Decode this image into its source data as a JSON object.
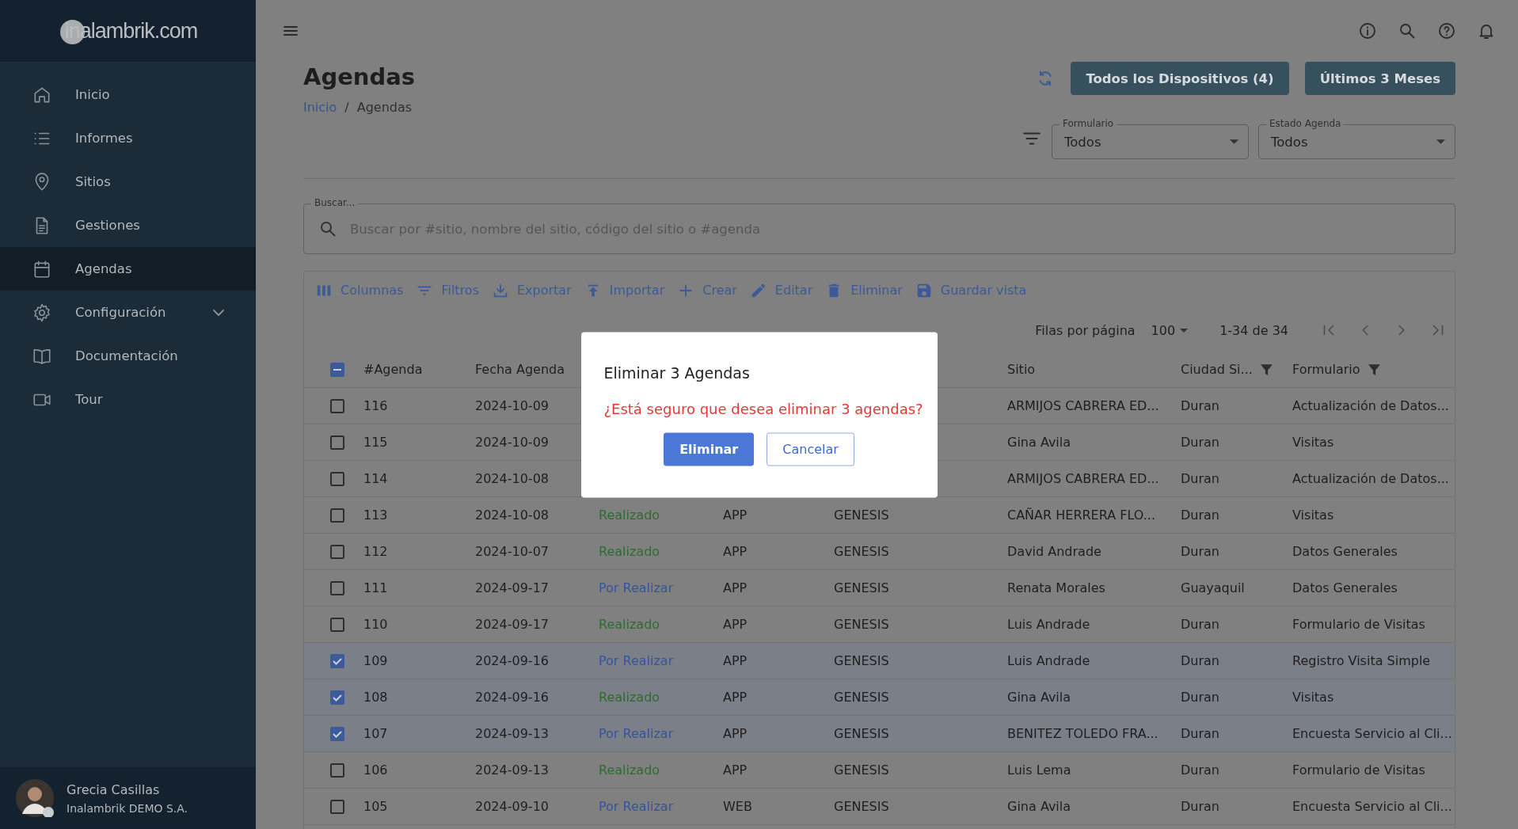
{
  "sidebar": {
    "logo": "inalambrik.com",
    "items": [
      {
        "label": "Inicio",
        "selected": false
      },
      {
        "label": "Informes",
        "selected": false
      },
      {
        "label": "Sitios",
        "selected": false
      },
      {
        "label": "Gestiones",
        "selected": false
      },
      {
        "label": "Agendas",
        "selected": true
      },
      {
        "label": "Configuración",
        "selected": false,
        "expanded": false
      },
      {
        "label": "Documentación",
        "selected": false
      },
      {
        "label": "Tour",
        "selected": false
      }
    ],
    "user": {
      "name": "Grecia Casillas",
      "company": "Inalambrik DEMO S.A."
    }
  },
  "page": {
    "title": "Agendas",
    "breadcrumb": [
      {
        "label": "Inicio",
        "kind": "link"
      },
      {
        "label": "/",
        "kind": "separator"
      },
      {
        "label": "Agendas",
        "kind": "current"
      }
    ],
    "actions": [
      "Todos los Dispositivos (4)",
      "Últimos 3 Meses"
    ],
    "filters": [
      {
        "label": "Formulario",
        "value": "Todos"
      },
      {
        "label": "Estado Agenda",
        "value": "Todos"
      }
    ],
    "search": {
      "label": "Buscar...",
      "placeholder": "Buscar por #sitio, nombre del sitio, código del sitio o #agenda"
    }
  },
  "toolbar": [
    "Columnas",
    "Filtros",
    "Exportar",
    "Importar",
    "Crear",
    "Editar",
    "Eliminar",
    "Guardar vista"
  ],
  "pagination": {
    "rows_label": "Filas por página",
    "rows_per_page": "100",
    "range": "1-34 de 34"
  },
  "table": {
    "header_partial": true,
    "columns": [
      {
        "label": "#Agenda",
        "filtered": false
      },
      {
        "label": "Fecha Agenda",
        "filtered": false
      },
      null,
      null,
      null,
      {
        "label": "Sitio",
        "filtered": false
      },
      {
        "label": "Ciudad Si...",
        "filtered": true
      },
      {
        "label": "Formulario",
        "filtered": true
      }
    ],
    "rows": [
      {
        "selected": false,
        "agenda": "116",
        "date": "2024-10-09",
        "site": "ARMIJOS CABRERA ED...",
        "city": "Duran",
        "form": "Actualización de Datos..."
      },
      {
        "selected": false,
        "agenda": "115",
        "date": "2024-10-09",
        "site": "Gina Avila",
        "city": "Duran",
        "form": "Visitas"
      },
      {
        "selected": false,
        "agenda": "114",
        "date": "2024-10-08",
        "site": "ARMIJOS CABRERA ED...",
        "city": "Duran",
        "form": "Actualización de Datos..."
      },
      {
        "selected": false,
        "agenda": "113",
        "date": "2024-10-08",
        "status": "Realizado",
        "done": true,
        "origin": "APP",
        "company": "GENESIS",
        "site": "CAÑAR HERRERA FLO...",
        "city": "Duran",
        "form": "Visitas"
      },
      {
        "selected": false,
        "agenda": "112",
        "date": "2024-10-07",
        "status": "Realizado",
        "done": true,
        "origin": "APP",
        "company": "GENESIS",
        "site": "David Andrade",
        "city": "Duran",
        "form": "Datos Generales"
      },
      {
        "selected": false,
        "agenda": "111",
        "date": "2024-09-17",
        "status": "Por Realizar",
        "done": false,
        "origin": "APP",
        "company": "GENESIS",
        "site": "Renata Morales",
        "city": "Guayaquil",
        "form": "Datos Generales"
      },
      {
        "selected": false,
        "agenda": "110",
        "date": "2024-09-17",
        "status": "Realizado",
        "done": true,
        "origin": "APP",
        "company": "GENESIS",
        "site": "Luis Andrade",
        "city": "Duran",
        "form": "Formulario de Visitas"
      },
      {
        "selected": true,
        "agenda": "109",
        "date": "2024-09-16",
        "status": "Por Realizar",
        "done": false,
        "origin": "APP",
        "company": "GENESIS",
        "site": "Luis Andrade",
        "city": "Duran",
        "form": "Registro Visita Simple"
      },
      {
        "selected": true,
        "agenda": "108",
        "date": "2024-09-16",
        "status": "Realizado",
        "done": true,
        "origin": "APP",
        "company": "GENESIS",
        "site": "Gina Avila",
        "city": "Duran",
        "form": "Visitas"
      },
      {
        "selected": true,
        "agenda": "107",
        "date": "2024-09-13",
        "status": "Por Realizar",
        "done": false,
        "origin": "APP",
        "company": "GENESIS",
        "site": "BENITEZ TOLEDO FRA...",
        "city": "Duran",
        "form": "Encuesta Servicio al Cli..."
      },
      {
        "selected": false,
        "agenda": "106",
        "date": "2024-09-13",
        "status": "Realizado",
        "done": true,
        "origin": "APP",
        "company": "GENESIS",
        "site": "Luis Lema",
        "city": "Duran",
        "form": "Formulario de Visitas"
      },
      {
        "selected": false,
        "agenda": "105",
        "date": "2024-09-10",
        "status": "Por Realizar",
        "done": false,
        "origin": "WEB",
        "company": "GENESIS",
        "site": "Gina Avila",
        "city": "Duran",
        "form": "Encuesta Servicio al Cli..."
      }
    ]
  },
  "dialog": {
    "title": "Eliminar 3 Agendas",
    "message": "¿Está seguro que desea eliminar 3 agendas?",
    "buttons": [
      {
        "label": "Eliminar",
        "kind": "primary"
      },
      {
        "label": "Cancelar",
        "kind": "secondary"
      }
    ]
  }
}
